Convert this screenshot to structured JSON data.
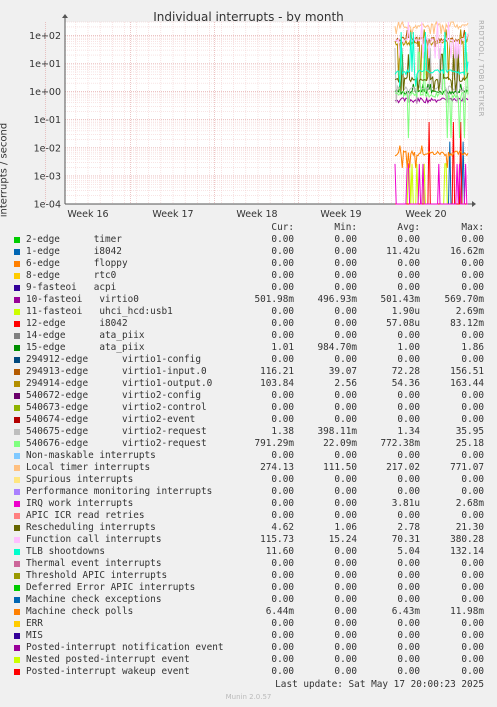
{
  "title": "Individual interrupts - by month",
  "watermark": "RRDTOOL / TOBI OETIKER",
  "munin": "Munin 2.0.57",
  "footer": "Last update: Sat May 17 20:00:23 2025",
  "columns": [
    "Cur:",
    "Min:",
    "Avg:",
    "Max:"
  ],
  "chart_data": {
    "type": "line",
    "title": "Individual interrupts - by month",
    "ylabel": "interrupts / second",
    "yscale": "log",
    "ylim": [
      0.0001,
      300
    ],
    "yticks": [
      "1e-04",
      "1e-03",
      "1e-02",
      "1e-01",
      "1e+00",
      "1e+01",
      "1e+02"
    ],
    "xticks": [
      "Week 16",
      "Week 17",
      "Week 18",
      "Week 19",
      "Week 20"
    ],
    "grid": true,
    "legend_placement": "bottom",
    "series": [
      {
        "name": "2-edge      timer",
        "color": "#00cc00",
        "cur": "0.00",
        "min": "0.00",
        "avg": "0.00",
        "max": "0.00"
      },
      {
        "name": "1-edge      i8042",
        "color": "#0066b3",
        "cur": "0.00",
        "min": "0.00",
        "avg": "11.42u",
        "max": "16.62m"
      },
      {
        "name": "6-edge      floppy",
        "color": "#ff8000",
        "cur": "0.00",
        "min": "0.00",
        "avg": "0.00",
        "max": "0.00"
      },
      {
        "name": "8-edge      rtc0",
        "color": "#ffcc00",
        "cur": "0.00",
        "min": "0.00",
        "avg": "0.00",
        "max": "0.00"
      },
      {
        "name": "9-fasteoi   acpi",
        "color": "#330099",
        "cur": "0.00",
        "min": "0.00",
        "avg": "0.00",
        "max": "0.00"
      },
      {
        "name": "10-fasteoi   virtio0",
        "color": "#990099",
        "cur": "501.98m",
        "min": "496.93m",
        "avg": "501.43m",
        "max": "569.70m"
      },
      {
        "name": "11-fasteoi   uhci_hcd:usb1",
        "color": "#ccff00",
        "cur": "0.00",
        "min": "0.00",
        "avg": "1.90u",
        "max": "2.69m"
      },
      {
        "name": "12-edge      i8042",
        "color": "#ff0000",
        "cur": "0.00",
        "min": "0.00",
        "avg": "57.08u",
        "max": "83.12m"
      },
      {
        "name": "14-edge      ata_piix",
        "color": "#808080",
        "cur": "0.00",
        "min": "0.00",
        "avg": "0.00",
        "max": "0.00"
      },
      {
        "name": "15-edge      ata_piix",
        "color": "#008f00",
        "cur": "1.01",
        "min": "984.70m",
        "avg": "1.00",
        "max": "1.86"
      },
      {
        "name": "294912-edge      virtio1-config",
        "color": "#00487d",
        "cur": "0.00",
        "min": "0.00",
        "avg": "0.00",
        "max": "0.00"
      },
      {
        "name": "294913-edge      virtio1-input.0",
        "color": "#b35a00",
        "cur": "116.21",
        "min": "39.07",
        "avg": "72.28",
        "max": "156.51"
      },
      {
        "name": "294914-edge      virtio1-output.0",
        "color": "#b38f00",
        "cur": "103.84",
        "min": "2.56",
        "avg": "54.36",
        "max": "163.44"
      },
      {
        "name": "540672-edge      virtio2-config",
        "color": "#6b006b",
        "cur": "0.00",
        "min": "0.00",
        "avg": "0.00",
        "max": "0.00"
      },
      {
        "name": "540673-edge      virtio2-control",
        "color": "#8fb300",
        "cur": "0.00",
        "min": "0.00",
        "avg": "0.00",
        "max": "0.00"
      },
      {
        "name": "540674-edge      virtio2-event",
        "color": "#b30000",
        "cur": "0.00",
        "min": "0.00",
        "avg": "0.00",
        "max": "0.00"
      },
      {
        "name": "540675-edge      virtio2-request",
        "color": "#bebebe",
        "cur": "1.38",
        "min": "398.11m",
        "avg": "1.34",
        "max": "35.95"
      },
      {
        "name": "540676-edge      virtio2-request",
        "color": "#80ff80",
        "cur": "791.29m",
        "min": "22.09m",
        "avg": "772.38m",
        "max": "25.18"
      },
      {
        "name": "Non-maskable interrupts",
        "color": "#80c9ff",
        "cur": "0.00",
        "min": "0.00",
        "avg": "0.00",
        "max": "0.00"
      },
      {
        "name": "Local timer interrupts",
        "color": "#ffc080",
        "cur": "274.13",
        "min": "111.50",
        "avg": "217.02",
        "max": "771.07"
      },
      {
        "name": "Spurious interrupts",
        "color": "#ffe680",
        "cur": "0.00",
        "min": "0.00",
        "avg": "0.00",
        "max": "0.00"
      },
      {
        "name": "Performance monitoring interrupts",
        "color": "#aa80ff",
        "cur": "0.00",
        "min": "0.00",
        "avg": "0.00",
        "max": "0.00"
      },
      {
        "name": "IRQ work interrupts",
        "color": "#ee00cc",
        "cur": "0.00",
        "min": "0.00",
        "avg": "3.81u",
        "max": "2.68m"
      },
      {
        "name": "APIC ICR read retries",
        "color": "#ff8080",
        "cur": "0.00",
        "min": "0.00",
        "avg": "0.00",
        "max": "0.00"
      },
      {
        "name": "Rescheduling interrupts",
        "color": "#666600",
        "cur": "4.62",
        "min": "1.06",
        "avg": "2.78",
        "max": "21.30"
      },
      {
        "name": "Function call interrupts",
        "color": "#ffbfff",
        "cur": "115.73",
        "min": "15.24",
        "avg": "70.31",
        "max": "380.28"
      },
      {
        "name": "TLB shootdowns",
        "color": "#00ffcc",
        "cur": "11.60",
        "min": "0.00",
        "avg": "5.04",
        "max": "132.14"
      },
      {
        "name": "Thermal event interrupts",
        "color": "#cc6699",
        "cur": "0.00",
        "min": "0.00",
        "avg": "0.00",
        "max": "0.00"
      },
      {
        "name": "Threshold APIC interrupts",
        "color": "#999900",
        "cur": "0.00",
        "min": "0.00",
        "avg": "0.00",
        "max": "0.00"
      },
      {
        "name": "Deferred Error APIC interrupts",
        "color": "#00cc00",
        "cur": "0.00",
        "min": "0.00",
        "avg": "0.00",
        "max": "0.00"
      },
      {
        "name": "Machine check exceptions",
        "color": "#0066b3",
        "cur": "0.00",
        "min": "0.00",
        "avg": "0.00",
        "max": "0.00"
      },
      {
        "name": "Machine check polls",
        "color": "#ff8000",
        "cur": "6.44m",
        "min": "0.00",
        "avg": "6.43m",
        "max": "11.98m"
      },
      {
        "name": "ERR",
        "color": "#ffcc00",
        "cur": "0.00",
        "min": "0.00",
        "avg": "0.00",
        "max": "0.00"
      },
      {
        "name": "MIS",
        "color": "#330099",
        "cur": "0.00",
        "min": "0.00",
        "avg": "0.00",
        "max": "0.00"
      },
      {
        "name": "Posted-interrupt notification event",
        "color": "#990099",
        "cur": "0.00",
        "min": "0.00",
        "avg": "0.00",
        "max": "0.00"
      },
      {
        "name": "Nested posted-interrupt event",
        "color": "#ccff00",
        "cur": "0.00",
        "min": "0.00",
        "avg": "0.00",
        "max": "0.00"
      },
      {
        "name": "Posted-interrupt wakeup event",
        "color": "#ff0000",
        "cur": "0.00",
        "min": "0.00",
        "avg": "0.00",
        "max": "0.00"
      }
    ]
  }
}
